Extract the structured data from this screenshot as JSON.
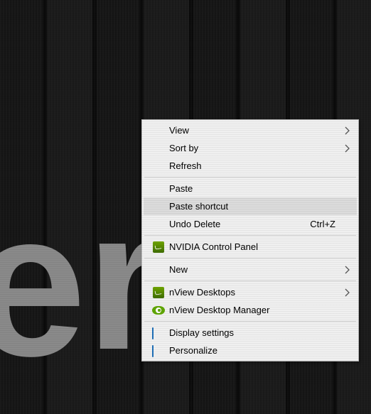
{
  "background_text": {
    "glyph1": "e",
    "glyph2": "r"
  },
  "menu": {
    "groups": [
      [
        {
          "id": "view",
          "label": "View",
          "submenu": true
        },
        {
          "id": "sort-by",
          "label": "Sort by",
          "submenu": true
        },
        {
          "id": "refresh",
          "label": "Refresh"
        }
      ],
      [
        {
          "id": "paste",
          "label": "Paste"
        },
        {
          "id": "paste-shortcut",
          "label": "Paste shortcut",
          "highlighted": true
        },
        {
          "id": "undo-delete",
          "label": "Undo Delete",
          "shortcut": "Ctrl+Z"
        }
      ],
      [
        {
          "id": "nvidia-cp",
          "label": "NVIDIA Control Panel",
          "icon": "nvidia-square"
        }
      ],
      [
        {
          "id": "new",
          "label": "New",
          "submenu": true
        }
      ],
      [
        {
          "id": "nview-desktops",
          "label": "nView Desktops",
          "icon": "nvidia-square",
          "submenu": true
        },
        {
          "id": "nview-desktop-mgr",
          "label": "nView Desktop Manager",
          "icon": "nvidia-eye"
        }
      ],
      [
        {
          "id": "display-settings",
          "label": "Display settings",
          "icon": "monitor"
        },
        {
          "id": "personalize",
          "label": "Personalize",
          "icon": "monitor-personalize"
        }
      ]
    ]
  }
}
